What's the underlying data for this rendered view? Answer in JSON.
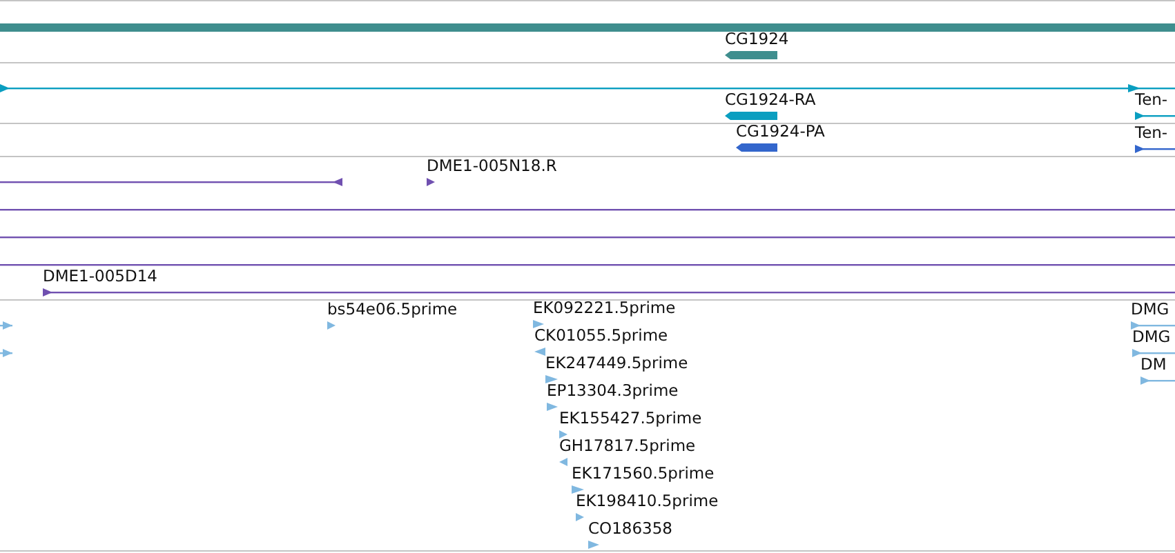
{
  "tracks": [
    {
      "color": "#3f8e8e",
      "features": [
        {
          "kind": "band"
        },
        {
          "kind": "block",
          "reverse": true,
          "label": "CG1924"
        }
      ]
    },
    {
      "color": "#0a9ec0",
      "features": [
        {
          "kind": "line",
          "reverse": false
        },
        {
          "kind": "tick",
          "reverse": false
        },
        {
          "kind": "block",
          "reverse": true,
          "label": "CG1924-RA"
        },
        {
          "kind": "line",
          "reverse": false,
          "label": "Ten-"
        }
      ]
    },
    {
      "color": "#3366cc",
      "features": [
        {
          "kind": "block",
          "reverse": true,
          "label": "CG1924-PA"
        },
        {
          "kind": "line",
          "reverse": false,
          "label": "Ten-"
        }
      ]
    },
    {
      "color": "#7050b0",
      "features": [
        {
          "kind": "line",
          "reverse": true
        },
        {
          "kind": "tick",
          "reverse": false,
          "label": "DME1-005N18.R"
        },
        {
          "kind": "line"
        },
        {
          "kind": "line"
        },
        {
          "kind": "line"
        },
        {
          "kind": "line",
          "reverse": false,
          "label": "DME1-005D14"
        }
      ]
    },
    {
      "color": "#80b8e0",
      "features": [
        {
          "kind": "line",
          "reverse": false
        },
        {
          "kind": "line",
          "reverse": false
        },
        {
          "kind": "tick",
          "reverse": false,
          "label": "bs54e06.5prime"
        },
        {
          "kind": "tick",
          "reverse": false,
          "label": "EK092221.5prime"
        },
        {
          "kind": "tick",
          "reverse": true,
          "label": "CK01055.5prime"
        },
        {
          "kind": "tick",
          "reverse": false,
          "label": "EK247449.5prime"
        },
        {
          "kind": "tick",
          "reverse": false,
          "label": "EP13304.3prime"
        },
        {
          "kind": "tick",
          "reverse": false,
          "label": "EK155427.5prime"
        },
        {
          "kind": "tick",
          "reverse": true,
          "label": "GH17817.5prime"
        },
        {
          "kind": "tick",
          "reverse": false,
          "label": "EK171560.5prime"
        },
        {
          "kind": "tick",
          "reverse": false,
          "label": "EK198410.5prime"
        },
        {
          "kind": "tick",
          "reverse": false,
          "label": "CO186358"
        },
        {
          "kind": "line",
          "reverse": false,
          "label": "DMG"
        },
        {
          "kind": "line",
          "reverse": false,
          "label": "DMG"
        },
        {
          "kind": "line",
          "reverse": false,
          "label": "DM"
        }
      ]
    }
  ]
}
